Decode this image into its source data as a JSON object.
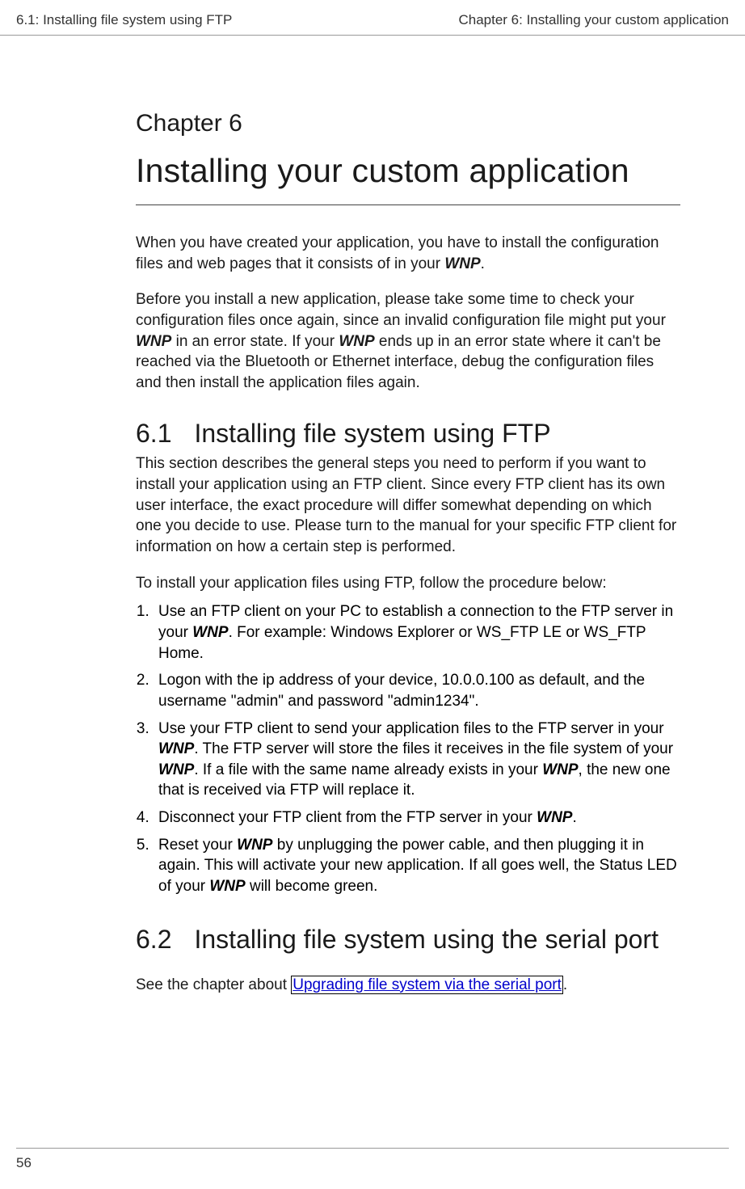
{
  "header": {
    "left": "6.1: Installing file system using FTP",
    "right": "Chapter 6: Installing your custom application"
  },
  "chapter": {
    "label": "Chapter 6",
    "title": "Installing your custom application"
  },
  "intro": {
    "p1_a": "When you have created your application, you have to install the configuration files and web pages that it consists of in your ",
    "p1_wnp": "WNP",
    "p1_b": ".",
    "p2_a": "Before you install a new application, please take some time to check your configuration files once again, since an invalid configuration file might put your ",
    "p2_wnp1": "WNP",
    "p2_b": " in an error state. If your ",
    "p2_wnp2": "WNP",
    "p2_c": " ends up in an error state where it can't be reached via the Bluetooth or Ethernet interface, debug the configuration files and then install the application files again."
  },
  "s61": {
    "num": "6.1",
    "title": "Installing file system using FTP",
    "p1": "This section describes the general steps you need to perform if you want to install your application using an FTP client. Since every FTP client has its own user interface, the exact procedure will differ somewhat depending on which one you decide to use. Please turn to the manual for your specific FTP client for information on how a certain step is performed.",
    "p2": "To install your application files using FTP, follow the procedure below:",
    "li1_a": "Use an FTP client on your PC to establish a connection to the FTP server in your ",
    "li1_wnp": "WNP",
    "li1_b": ". For example: Windows Explorer or WS_FTP LE or WS_FTP Home.",
    "li2": "Logon with the ip address of your device, 10.0.0.100 as default, and the username \"admin\" and password \"admin1234\".",
    "li3_a": "Use your FTP client to send your application files to the FTP server in your ",
    "li3_wnp1": "WNP",
    "li3_b": ". The FTP server will store the files it receives in the file system of your ",
    "li3_wnp2": "WNP",
    "li3_c": ". If a file with the same name already exists in your ",
    "li3_wnp3": "WNP",
    "li3_d": ", the new one that is received via FTP will replace it.",
    "li4_a": "Disconnect your FTP client from the FTP server in your ",
    "li4_wnp": "WNP",
    "li4_b": ".",
    "li5_a": "Reset your ",
    "li5_wnp1": "WNP",
    "li5_b": " by unplugging the power cable, and then plugging it in again. This will activate your new application. If all goes well, the Status LED of your ",
    "li5_wnp2": "WNP",
    "li5_c": " will become green."
  },
  "s62": {
    "num": "6.2",
    "title": "Installing file system using the serial port",
    "p1_a": "See the chapter about ",
    "p1_link": "Upgrading file system via the serial port",
    "p1_b": "."
  },
  "footer": {
    "page": "56"
  }
}
